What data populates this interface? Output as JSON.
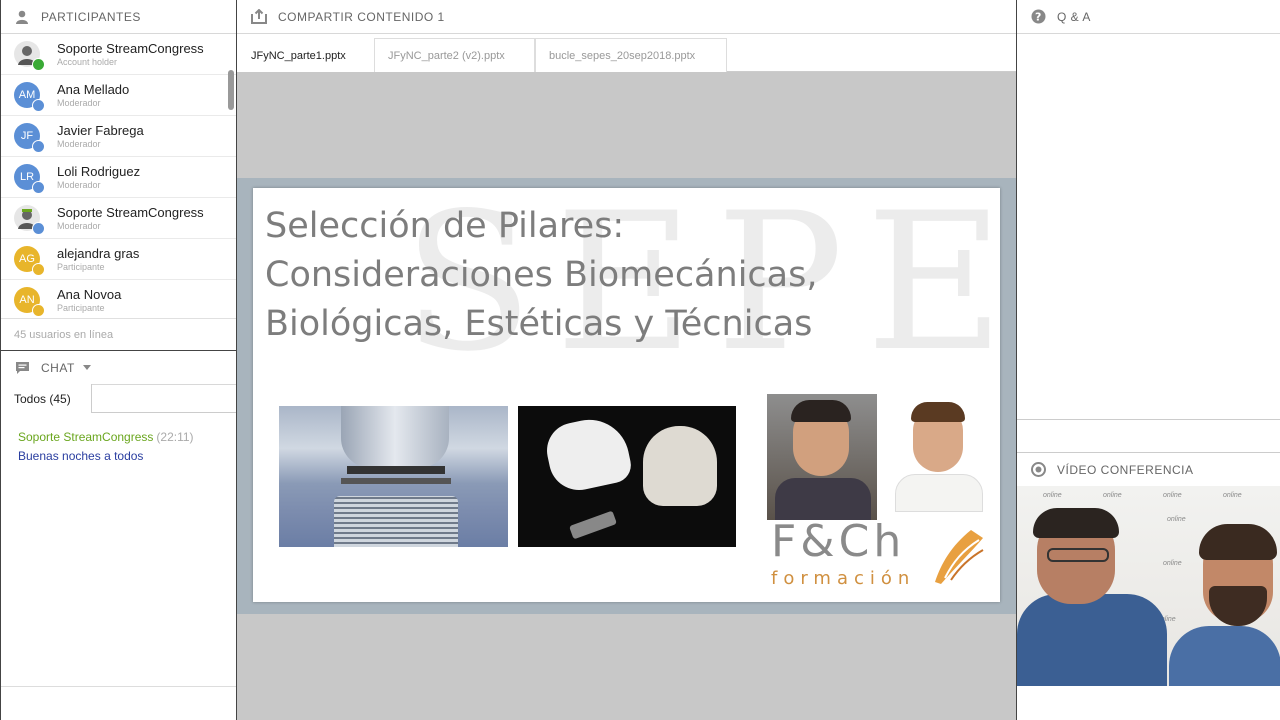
{
  "participants": {
    "title": "PARTICIPANTES",
    "list": [
      {
        "initials": "",
        "name": "Soporte StreamCongress",
        "role": "Account holder",
        "color": "#777777",
        "dot": "#3aaa35"
      },
      {
        "initials": "AM",
        "name": "Ana Mellado",
        "role": "Moderador",
        "color": "#5b8fd6",
        "dot": "#5b8fd6"
      },
      {
        "initials": "JF",
        "name": "Javier Fabrega",
        "role": "Moderador",
        "color": "#5b8fd6",
        "dot": "#5b8fd6"
      },
      {
        "initials": "LR",
        "name": "Loli Rodriguez",
        "role": "Moderador",
        "color": "#5b8fd6",
        "dot": "#5b8fd6"
      },
      {
        "initials": "",
        "name": "Soporte   StreamCongress",
        "role": "Moderador",
        "color": "#777777",
        "dot": "#5b8fd6"
      },
      {
        "initials": "AG",
        "name": "alejandra gras",
        "role": "Participante",
        "color": "#e8b52b",
        "dot": "#e8b52b"
      },
      {
        "initials": "AN",
        "name": "Ana Novoa",
        "role": "Participante",
        "color": "#e8b52b",
        "dot": "#e8b52b"
      }
    ],
    "online_count": "45 usuarios en línea"
  },
  "chat": {
    "title": "CHAT",
    "tab_label": "Todos (45)",
    "messages": [
      {
        "user": "Soporte StreamCongress",
        "time": "(22:11)",
        "text": "Buenas noches a todos"
      }
    ]
  },
  "share": {
    "title": "COMPARTIR CONTENIDO 1",
    "tabs": [
      "JFyNC_parte1.pptx",
      "JFyNC_parte2 (v2).pptx",
      "bucle_sepes_20sep2018.pptx"
    ],
    "active_tab": 0
  },
  "slide": {
    "title_lines": [
      "Selección de Pilares:",
      "Consideraciones Biomecánicas,",
      "Biológicas, Estéticas y Técnicas"
    ],
    "watermark": "SEPES",
    "logo_main": "F&Ch",
    "logo_sub": "formación"
  },
  "qa": {
    "title": "Q & A"
  },
  "video": {
    "title": "VÍDEO CONFERENCIA",
    "watermark": "online"
  },
  "colors": {
    "accent_green": "#6aa61e",
    "message_blue": "#2a3ea0",
    "moderator_blue": "#5b8fd6",
    "participant_yellow": "#e8b52b"
  }
}
